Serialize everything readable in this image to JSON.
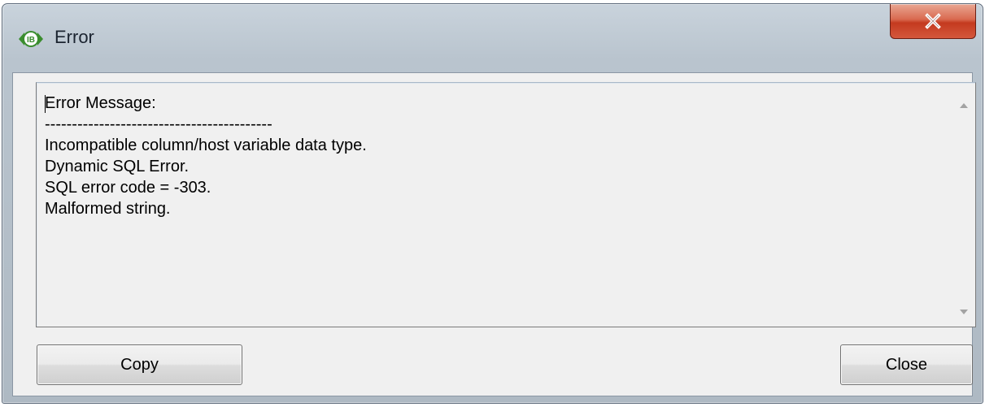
{
  "window": {
    "title": "Error",
    "icon": "ib-icon",
    "close_glyph": "X"
  },
  "message": {
    "lines": [
      "Error Message:",
      "------------------------------------------",
      "Incompatible column/host variable data type.",
      "Dynamic SQL Error.",
      "SQL error code = -303.",
      "Malformed string."
    ]
  },
  "buttons": {
    "copy_label": "Copy",
    "close_label": "Close"
  },
  "colors": {
    "close_button": "#c43a1f",
    "app_icon": "#3a8d2e"
  }
}
